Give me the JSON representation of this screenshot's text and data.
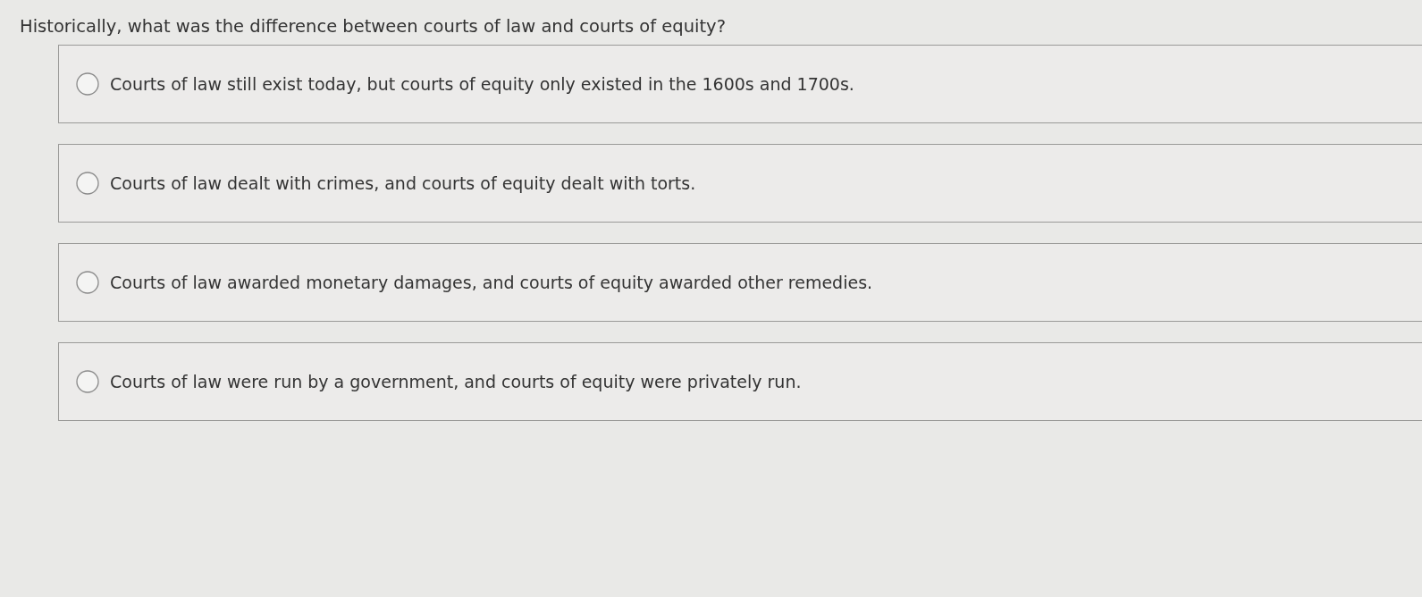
{
  "question": {
    "text": "Historically, what was the difference between courts of law and courts of equity?"
  },
  "options": [
    {
      "label": "Courts of law still exist today, but courts of equity only existed in the 1600s and 1700s.",
      "selected": false
    },
    {
      "label": "Courts of law dealt with crimes, and courts of equity dealt with torts.",
      "selected": false
    },
    {
      "label": "Courts of law awarded monetary damages, and courts of equity awarded other remedies.",
      "selected": false
    },
    {
      "label": "Courts of law were run by a government, and courts of equity were privately run.",
      "selected": false
    }
  ]
}
